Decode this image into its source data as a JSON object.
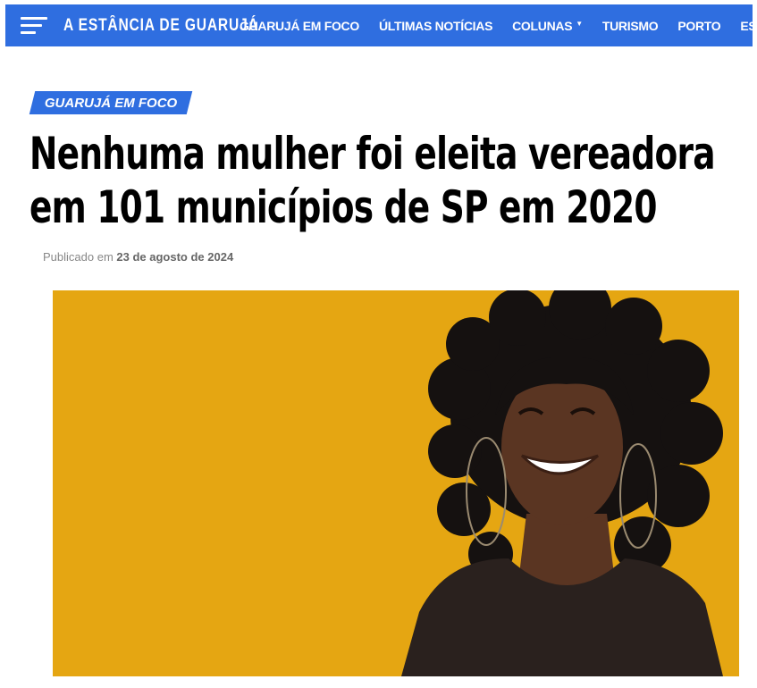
{
  "header": {
    "site_title": "A ESTÂNCIA DE GUARUJÁ",
    "nav": [
      {
        "label": "GUARUJÁ EM FOCO"
      },
      {
        "label": "ÚLTIMAS NOTÍCIAS"
      },
      {
        "label": "COLUNAS",
        "has_dropdown": true
      },
      {
        "label": "TURISMO"
      },
      {
        "label": "PORTO"
      },
      {
        "label": "ESTÂNCIA DO LEITOR"
      }
    ]
  },
  "article": {
    "category": "GUARUJÁ EM FOCO",
    "title": "Nenhuma mulher foi eleita vereadora em 101 municípios de SP em 2020",
    "published_prefix": "Publicado em",
    "published_date": "23 de agosto de 2024"
  },
  "theme": {
    "brand_blue": "#2f6ee0",
    "hero_background": "#e5a612",
    "clothing": "#2a211e",
    "hair": "#151110",
    "skin": "#5a3522"
  },
  "icons": {
    "menu": "hamburger-menu-icon",
    "dropdown": "chevron-down-icon"
  }
}
